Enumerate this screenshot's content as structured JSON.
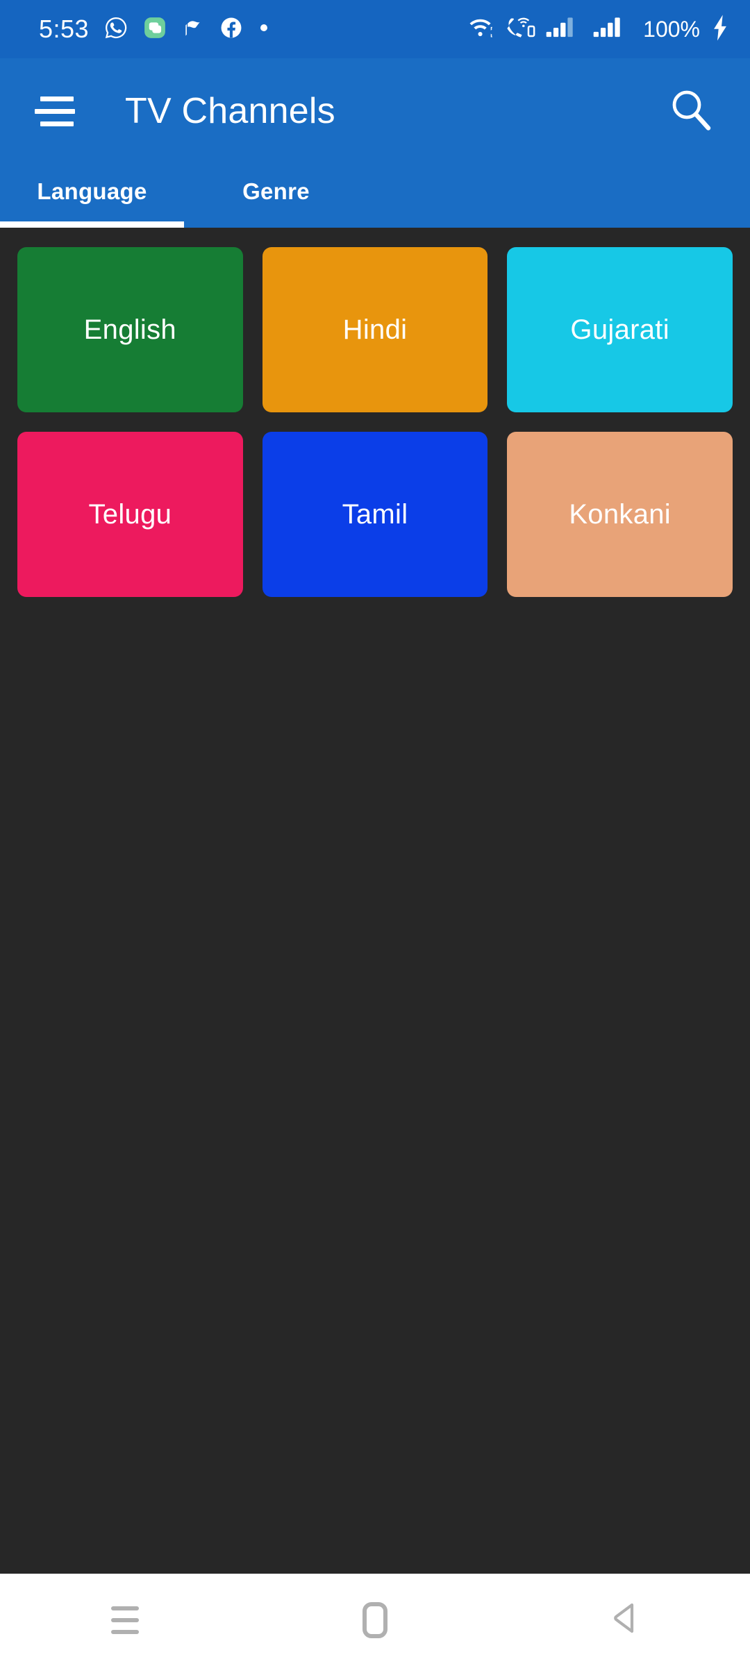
{
  "status_bar": {
    "time": "5:53",
    "battery_percent": "100%",
    "background_color": "#1565C0",
    "left_icons": [
      "whatsapp-icon",
      "messages-icon",
      "flag-icon",
      "facebook-icon",
      "dot-icon"
    ],
    "right_icons": [
      "wifi-icon",
      "volte-call-icon",
      "signal-bars-sim1-icon",
      "signal-bars-sim2-icon",
      "charging-bolt-icon"
    ]
  },
  "app_bar": {
    "title": "TV Channels",
    "menu_icon": "hamburger-menu-icon",
    "search_icon": "search-icon",
    "background_color": "#1A6DC4",
    "tabs": [
      {
        "label": "Language",
        "active": true
      },
      {
        "label": "Genre",
        "active": false
      }
    ]
  },
  "content": {
    "background_color": "#272727",
    "tiles": [
      {
        "label": "English",
        "color": "#167D34"
      },
      {
        "label": "Hindi",
        "color": "#E8950D"
      },
      {
        "label": "Gujarati",
        "color": "#17C8E6"
      },
      {
        "label": "Telugu",
        "color": "#ED1A5E"
      },
      {
        "label": "Tamil",
        "color": "#0B3EE8"
      },
      {
        "label": "Konkani",
        "color": "#E8A378"
      }
    ]
  },
  "nav_bar": {
    "background_color": "#FFFFFF",
    "buttons": [
      {
        "name": "recents-icon"
      },
      {
        "name": "home-icon"
      },
      {
        "name": "back-icon"
      }
    ]
  }
}
